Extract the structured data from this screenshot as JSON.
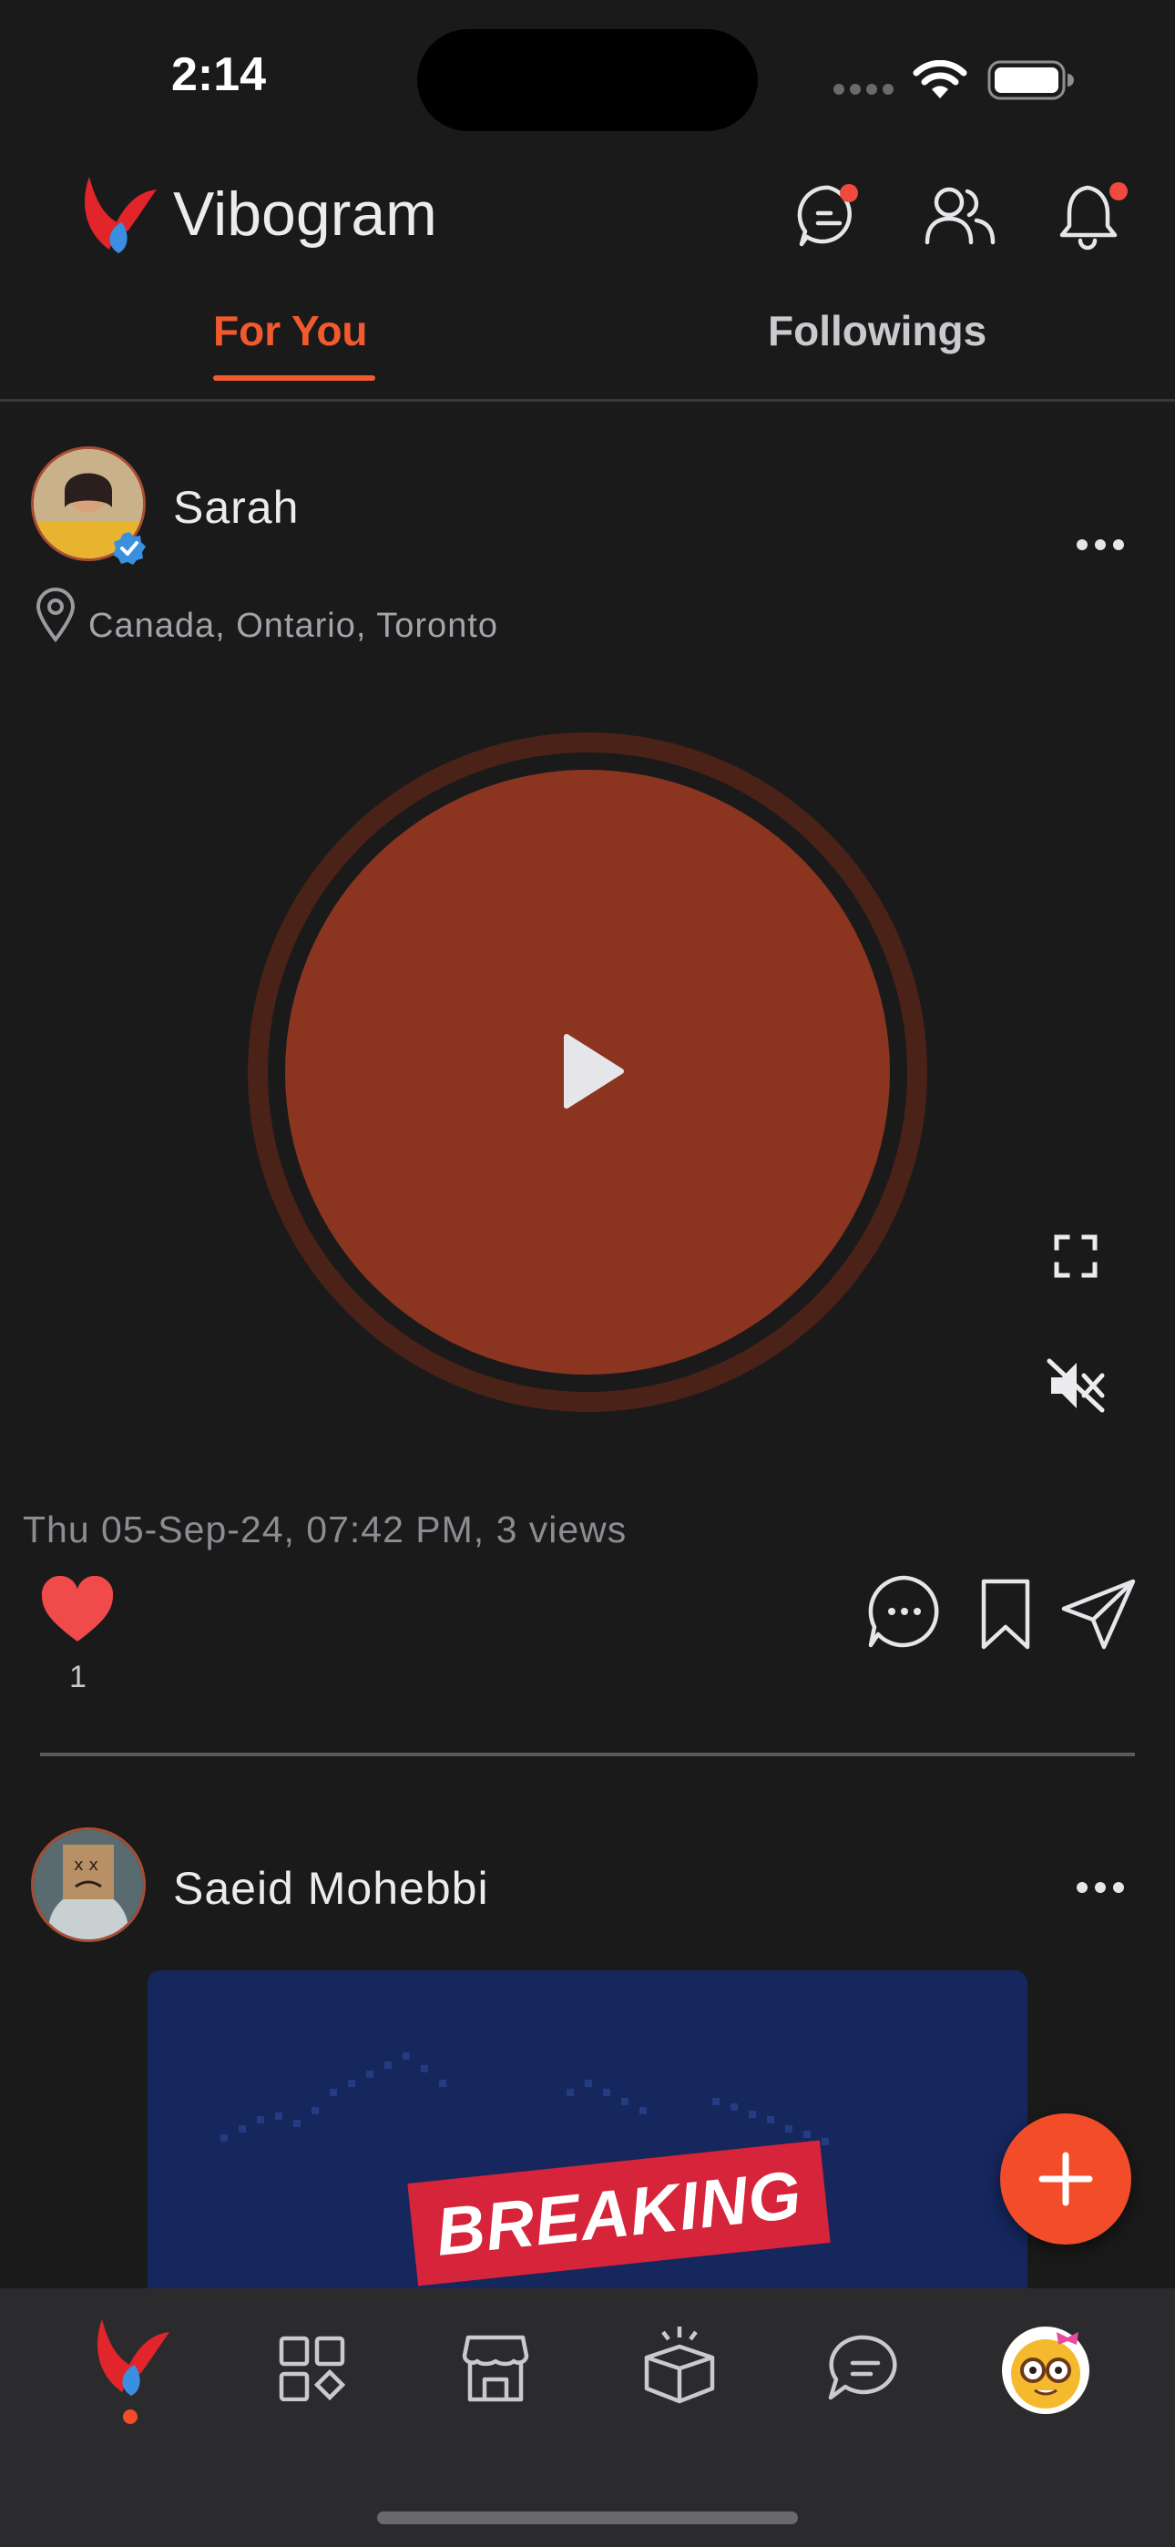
{
  "status_bar": {
    "time": "2:14"
  },
  "app": {
    "title": "Vibogram"
  },
  "header": {
    "icons": [
      "chat-icon",
      "friends-icon",
      "bell-icon"
    ],
    "notification_dot_color": "#f04a3e"
  },
  "tabs": [
    {
      "label": "For You",
      "active": true
    },
    {
      "label": "Followings",
      "active": false
    }
  ],
  "posts": [
    {
      "username": "Sarah",
      "verified": true,
      "location": "Canada, Ontario, Toronto",
      "media": "voice",
      "meta": "Thu 05-Sep-24, 07:42 PM, 3 views",
      "likes": "1",
      "liked": true
    },
    {
      "username": "Saeid Mohebbi",
      "media_text": "BREAKING"
    }
  ],
  "bottom_nav": {
    "items": [
      "home-logo-icon",
      "apps-icon",
      "store-icon",
      "gift-box-icon",
      "messages-icon",
      "profile-emoji-avatar"
    ]
  },
  "colors": {
    "accent": "#f25a2e",
    "background": "#1a1a1b",
    "voice_circle": "#8b3521",
    "like": "#f04a4a"
  }
}
